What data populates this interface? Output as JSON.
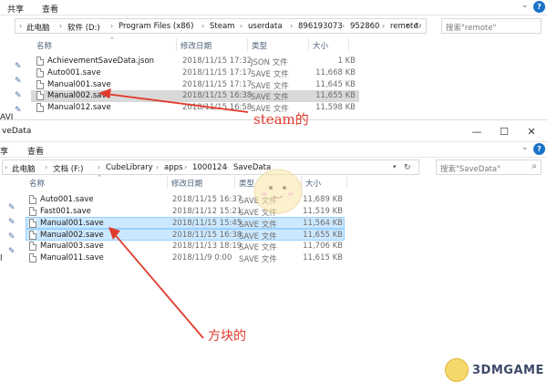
{
  "top_window": {
    "ribbon": {
      "tabs": [
        "共享",
        "查看"
      ]
    },
    "address": {
      "crumbs": [
        "此电脑",
        "软件 (D:)",
        "Program Files (x86)",
        "Steam",
        "userdata",
        "896193073",
        "952860",
        "remote"
      ]
    },
    "search": {
      "placeholder": "搜索\"remote\""
    },
    "columns": {
      "name": "名称",
      "date": "修改日期",
      "type": "类型",
      "size": "大小"
    },
    "files": [
      {
        "name": "AchievementSaveData.json",
        "date": "2018/11/15 17:32",
        "type": "JSON 文件",
        "size": "1 KB"
      },
      {
        "name": "Auto001.save",
        "date": "2018/11/15 17:17",
        "type": "SAVE 文件",
        "size": "11,668 KB"
      },
      {
        "name": "Manual001.save",
        "date": "2018/11/15 17:17",
        "type": "SAVE 文件",
        "size": "11,645 KB"
      },
      {
        "name": "Manual002.save",
        "date": "2018/11/15 16:38",
        "type": "SAVE 文件",
        "size": "11,655 KB"
      },
      {
        "name": "Manual012.save",
        "date": "2018/11/15 16:58",
        "type": "SAVE 文件",
        "size": "11,598 KB"
      }
    ],
    "nav_text": "AVI"
  },
  "bottom_window": {
    "title": "veData",
    "ribbon": {
      "tabs": [
        "享",
        "查看"
      ]
    },
    "address": {
      "crumbs": [
        "此电脑",
        "文档 (F:)",
        "CubeLibrary",
        "apps",
        "1000124",
        "SaveData"
      ]
    },
    "search": {
      "placeholder": "搜索\"SaveData\""
    },
    "columns": {
      "name": "名称",
      "date": "修改日期",
      "type": "类型",
      "size": "大小"
    },
    "files": [
      {
        "name": "Auto001.save",
        "date": "2018/11/15 16:37",
        "type": "SAVE 文件",
        "size": "11,689 KB"
      },
      {
        "name": "Fast001.save",
        "date": "2018/11/12 15:21",
        "type": "SAVE 文件",
        "size": "11,519 KB"
      },
      {
        "name": "Manual001.save",
        "date": "2018/11/15 15:45",
        "type": "SAVE 文件",
        "size": "11,564 KB"
      },
      {
        "name": "Manual002.save",
        "date": "2018/11/15 16:38",
        "type": "SAVE 文件",
        "size": "11,655 KB"
      },
      {
        "name": "Manual003.save",
        "date": "2018/11/13 18:19",
        "type": "SAVE 文件",
        "size": "11,706 KB"
      },
      {
        "name": "Manual011.save",
        "date": "2018/11/9 0:00",
        "type": "SAVE 文件",
        "size": "11,615 KB"
      }
    ],
    "nav_text": "l"
  },
  "annotations": {
    "steam": "steam的",
    "cube": "方块的"
  },
  "watermark": {
    "text": "3DMGAME"
  },
  "colors": {
    "annotation_red": "#e23b2e",
    "selection_blue": "#cce8ff",
    "selection_gray": "#d9d9d9"
  }
}
